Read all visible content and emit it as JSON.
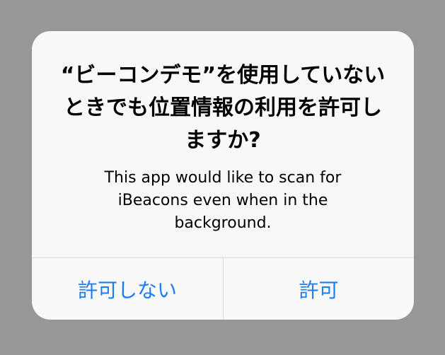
{
  "alert": {
    "title": "“ビーコンデモ”を使用していないときでも位置情報の利用を許可しますか?",
    "message": "This app would like to scan for iBeacons even when in the background.",
    "buttons": {
      "deny": "許可しない",
      "allow": "許可"
    }
  },
  "colors": {
    "backdrop": "#979797",
    "alert_background": "#f8f8f8",
    "button_text": "#1a7cf5",
    "divider": "#dbdbdb"
  }
}
